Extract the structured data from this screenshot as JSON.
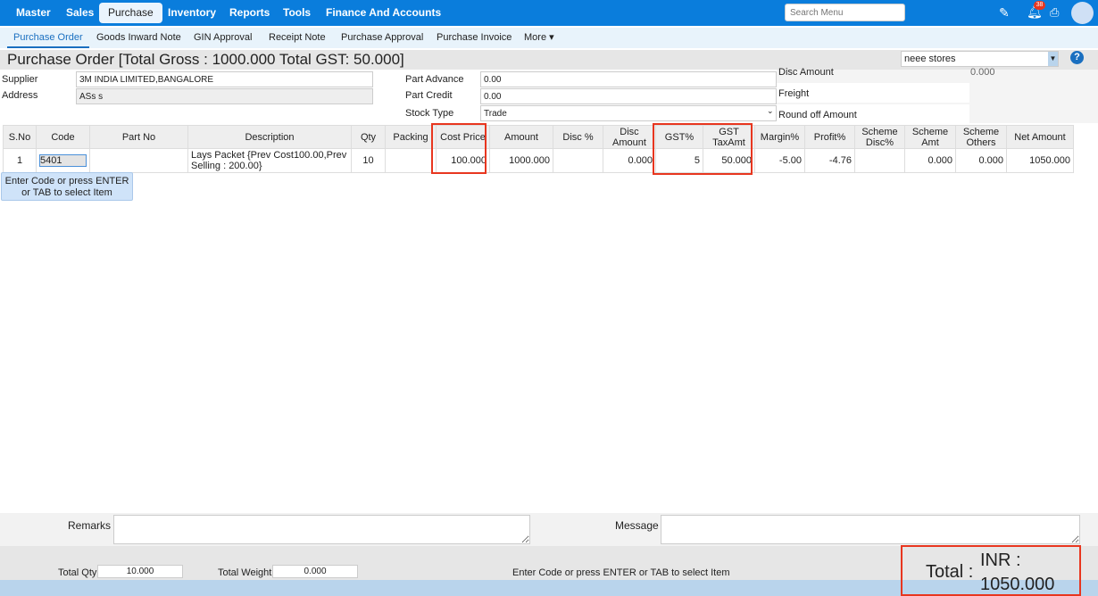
{
  "nav": {
    "items": [
      "Master",
      "Sales",
      "Purchase",
      "Inventory",
      "Reports",
      "Tools",
      "Finance And Accounts"
    ],
    "active": "Purchase",
    "search_placeholder": "Search Menu",
    "notification_count": "38"
  },
  "subnav": {
    "items": [
      "Purchase Order",
      "Goods Inward Note",
      "GIN Approval",
      "Receipt Note",
      "Purchase Approval",
      "Purchase Invoice",
      "More"
    ],
    "active": "Purchase Order"
  },
  "page": {
    "title": "Purchase Order [Total Gross : 1000.000 Total GST: 50.000]",
    "store": "neee stores"
  },
  "form": {
    "supplier_label": "Supplier",
    "supplier": "3M INDIA LIMITED,BANGALORE",
    "address_label": "Address",
    "address": "ASs s",
    "part_advance_label": "Part Advance",
    "part_advance": "0.00",
    "part_credit_label": "Part Credit",
    "part_credit": "0.00",
    "stock_type_label": "Stock Type",
    "stock_type": "Trade",
    "disc_amount_label": "Disc Amount",
    "disc_amount": "0.000",
    "freight_label": "Freight",
    "round_off_label": "Round off Amount"
  },
  "table": {
    "columns": [
      "S.No",
      "Code",
      "Part No",
      "Description",
      "Qty",
      "Packing",
      "Cost Price",
      "Amount",
      "Disc %",
      "Disc Amount",
      "GST%",
      "GST TaxAmt",
      "Margin%",
      "Profit%",
      "Scheme Disc%",
      "Scheme Amt",
      "Scheme Others",
      "Net Amount"
    ],
    "rows": [
      [
        "1",
        "5401",
        "",
        "Lays Packet {Prev Cost100.00,Prev Selling : 200.00}",
        "10",
        "",
        "100.000",
        "1000.000",
        "",
        "0.000",
        "5",
        "50.000",
        "-5.00",
        "-4.76",
        "",
        "0.000",
        "0.000",
        "1050.000"
      ]
    ]
  },
  "tooltip": "Enter Code or press ENTER or TAB to select Item",
  "footer": {
    "remarks_label": "Remarks",
    "message_label": "Message",
    "total_qty_label": "Total Qty",
    "total_qty": "10.000",
    "total_weight_label": "Total Weight",
    "total_weight": "0.000",
    "status": "Enter Code or press ENTER or TAB to select Item",
    "total_label": "Total :",
    "currency": "INR :",
    "total": "1050.000"
  }
}
